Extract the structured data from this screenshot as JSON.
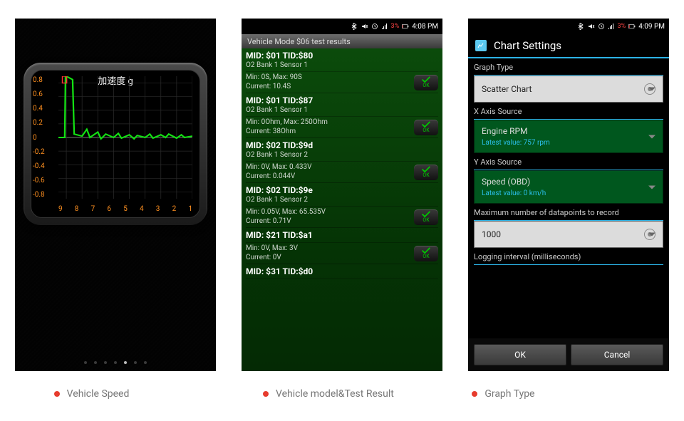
{
  "status_bar": {
    "battery_pct": "3%",
    "time_left": "4:08 PM",
    "time_right": "4:09 PM"
  },
  "phone1": {
    "pager_count": 7,
    "pager_active_index": 4
  },
  "phone2": {
    "header": "Vehicle Mode $06 test results",
    "ok_label": "OK",
    "blocks": [
      {
        "mid": "MID: $01 TID:$80",
        "desc": "O2 Bank 1 Sensor 1",
        "min": "Min: 0S, Max: 90S",
        "cur": "Current: 10.4S"
      },
      {
        "mid": "MID: $01 TID:$87",
        "desc": "O2 Bank 1 Sensor 1",
        "min": "Min: 0Ohm, Max: 250Ohm",
        "cur": "Current: 38Ohm"
      },
      {
        "mid": "MID: $02 TID:$9d",
        "desc": "O2 Bank 1 Sensor 2",
        "min": "Min: 0V, Max: 0.433V",
        "cur": "Current: 0.044V"
      },
      {
        "mid": "MID: $02 TID:$9e",
        "desc": "O2 Bank 1 Sensor 2",
        "min": "Min: 0.05V, Max: 65.535V",
        "cur": "Current: 0.71V"
      },
      {
        "mid": "MID: $21 TID:$a1",
        "desc": "",
        "min": "Min: 0V, Max: 3V",
        "cur": "Current: 0V"
      },
      {
        "mid": "MID: $31 TID:$d0",
        "desc": "",
        "min": "",
        "cur": ""
      }
    ]
  },
  "phone3": {
    "title": "Chart Settings",
    "graph_type_label": "Graph Type",
    "graph_type_value": "Scatter Chart",
    "x_axis_label": "X Axis Source",
    "x_axis_value": "Engine RPM",
    "x_axis_latest": "Latest value: 757 rpm",
    "y_axis_label": "Y Axis Source",
    "y_axis_value": "Speed (OBD)",
    "y_axis_latest": "Latest value: 0 km/h",
    "max_points_label": "Maximum number of datapoints to record",
    "max_points_value": "1000",
    "interval_label": "Logging interval (milliseconds)",
    "ok": "OK",
    "cancel": "Cancel"
  },
  "captions": {
    "c1": "Vehicle Speed",
    "c2": "Vehicle model&Test Result",
    "c3": "Graph Type"
  },
  "chart_data": {
    "type": "line",
    "title": "加速度 g",
    "xlabel": "",
    "ylabel": "",
    "y_ticks": [
      0.8,
      0.6,
      0.4,
      0.2,
      0,
      -0.2,
      -0.4,
      -0.6,
      -0.8
    ],
    "x_ticks": [
      9,
      8,
      7,
      6,
      5,
      4,
      3,
      2,
      1
    ],
    "ylim": [
      -0.9,
      0.9
    ],
    "x": [
      9.5,
      9.1,
      9.05,
      9.0,
      8.6,
      8.5,
      8.0,
      7.7,
      7.5,
      7.0,
      6.8,
      6.5,
      6.0,
      5.7,
      5.5,
      5.0,
      4.7,
      4.5,
      4.0,
      3.7,
      3.5,
      3.0,
      2.7,
      2.5,
      2.0,
      1.7,
      1.5,
      1.0
    ],
    "y": [
      0,
      0,
      0.9,
      0.9,
      0.85,
      0.05,
      0.02,
      0.12,
      0.0,
      0.08,
      -0.02,
      0.05,
      0.0,
      0.06,
      -0.01,
      0.04,
      -0.02,
      0.03,
      0.0,
      0.05,
      -0.01,
      0.04,
      0.0,
      0.05,
      -0.01,
      0.04,
      0.0,
      0.02
    ],
    "series": [
      {
        "name": "加速度",
        "color": "#13e213"
      }
    ],
    "box_x": 9.0,
    "box_w": 0.25,
    "box_y_top": 0.9,
    "box_y_bot": 0.8
  }
}
